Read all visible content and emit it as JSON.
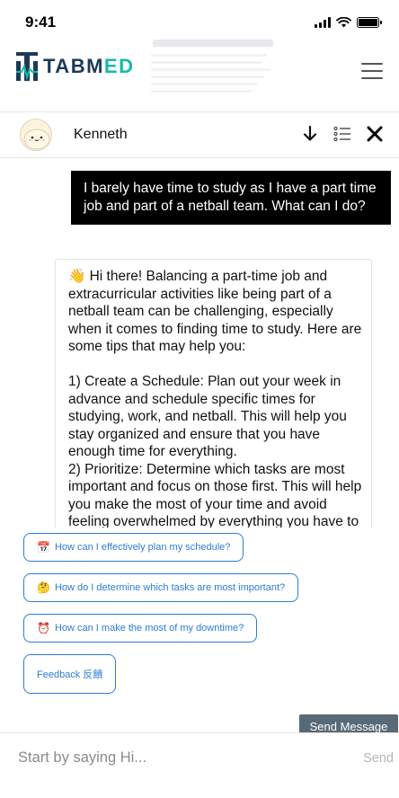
{
  "status_bar": {
    "time": "9:41"
  },
  "app_header": {
    "logo_text_primary": "TABM",
    "logo_text_accent": "ED",
    "logo_colors": {
      "navy": "#1b3a57",
      "teal": "#18b9a6"
    }
  },
  "chat_header": {
    "agent_name": "Kenneth",
    "icons": [
      "arrow-down-icon",
      "list-icon",
      "close-icon"
    ]
  },
  "messages": {
    "user_message": "I barely have time to study as I have a part time job and part of a netball team. What can I do?",
    "bot_intro": "👋 Hi there! Balancing a part-time job and extracurricular activities like being part of a netball team can be challenging, especially when it comes to finding time to study. Here are some tips that may help you:",
    "bot_tips": "1) Create a Schedule: Plan out your week in advance and schedule specific times for studying, work, and netball. This will help you stay organized and ensure that you have enough time for everything.\n2) Prioritize: Determine which tasks are most important and focus on those first. This will help you make the most of your time and avoid feeling overwhelmed by everything you have to do."
  },
  "suggestions": [
    {
      "emoji": "📅",
      "label": "How can I effectively plan my schedule?"
    },
    {
      "emoji": "🤔",
      "label": "How do I determine which tasks are most important?"
    },
    {
      "emoji": "⏰",
      "label": "How can I make the most of my downtime?"
    }
  ],
  "feedback_button": "Feedback 反饋",
  "tooltip": "Send Message",
  "composer": {
    "placeholder": "Start by saying Hi...",
    "send_label": "Send"
  },
  "colors": {
    "accent_blue": "#2d7bd8",
    "tooltip_bg": "#586a78",
    "user_bubble_bg": "#000000"
  }
}
